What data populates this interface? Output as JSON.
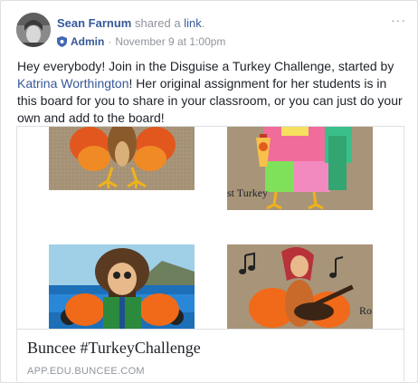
{
  "post": {
    "author": "Sean Farnum",
    "action_prefix": " shared a ",
    "action_link": "link",
    "action_suffix": ".",
    "role": "Admin",
    "separator": "·",
    "timestamp": "November 9 at 1:00pm",
    "more_label": "···",
    "text_part1": "Hey everybody! Join in the Disguise a Turkey Challenge, started by ",
    "mention": "Katrina Worthington",
    "text_part2": "! Her original assignment for her students is in this board for you to share in your classroom, or you can just do your own and add to the board!"
  },
  "attachment": {
    "images": [
      {
        "name": "turkey-drawing-1"
      },
      {
        "name": "turkey-drawing-2",
        "caption": "st Turkey"
      },
      {
        "name": "turkey-drawing-3"
      },
      {
        "name": "turkey-drawing-4",
        "caption": "Ro"
      }
    ],
    "title": "Buncee #TurkeyChallenge",
    "domain": "APP.EDU.BUNCEE.COM"
  },
  "icons": {
    "shield": "shield-icon",
    "more": "more-options-icon"
  },
  "colors": {
    "link": "#365899",
    "meta": "#90949c",
    "text": "#1d2129",
    "burlap": "#a89478"
  }
}
